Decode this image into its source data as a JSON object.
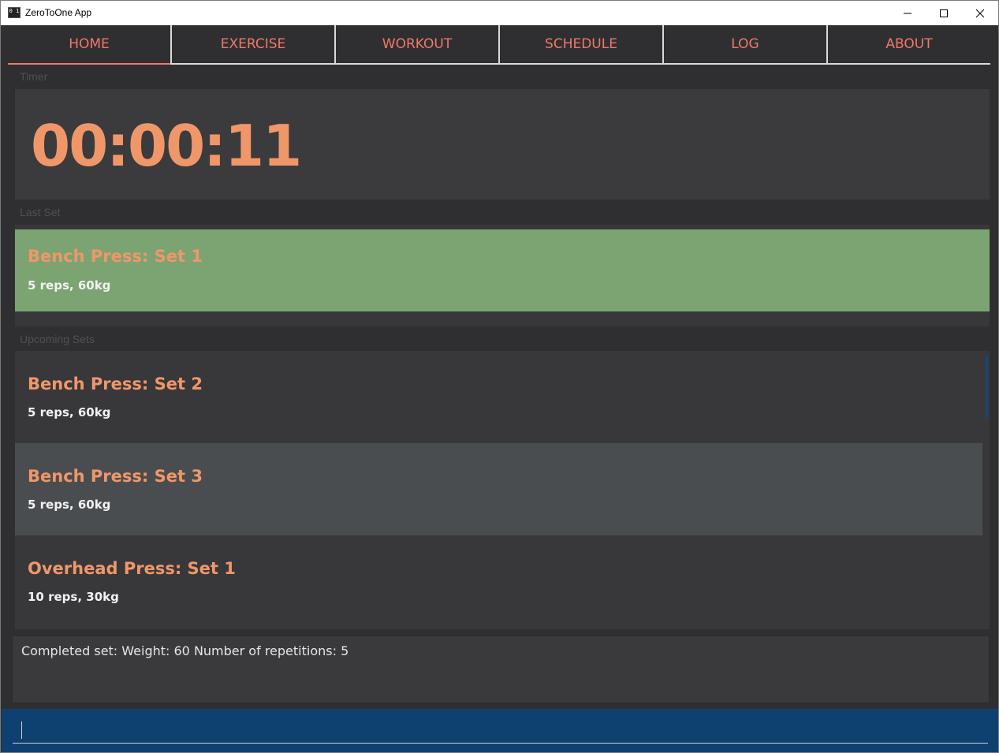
{
  "window": {
    "title": "ZeroToOne App",
    "icon_text": "0 1",
    "app_icon": "app-icon"
  },
  "tabs": [
    {
      "label": "HOME",
      "active": true
    },
    {
      "label": "EXERCISE",
      "active": false
    },
    {
      "label": "WORKOUT",
      "active": false
    },
    {
      "label": "SCHEDULE",
      "active": false
    },
    {
      "label": "LOG",
      "active": false
    },
    {
      "label": "ABOUT",
      "active": false
    }
  ],
  "timer": {
    "section_label": "Timer",
    "value": "00:00:11"
  },
  "last_set": {
    "section_label": "Last Set",
    "title": "Bench Press: Set 1",
    "detail": "5 reps, 60kg"
  },
  "upcoming": {
    "section_label": "Upcoming Sets",
    "items": [
      {
        "title": "Bench Press: Set 2",
        "detail": "5 reps, 60kg"
      },
      {
        "title": "Bench Press: Set 3",
        "detail": "5 reps, 60kg"
      },
      {
        "title": "Overhead Press: Set 1",
        "detail": "10 reps, 30kg"
      }
    ]
  },
  "result": {
    "text": "Completed set: Weight: 60 Number of repetitions: 5"
  },
  "command": {
    "value": "",
    "placeholder": ""
  },
  "colors": {
    "accent": "#f0776a",
    "title_orange": "#f0976a",
    "last_set_bg": "#7ca472",
    "selected_row_bg": "#4a4d50",
    "command_bg": "#0f4170"
  }
}
